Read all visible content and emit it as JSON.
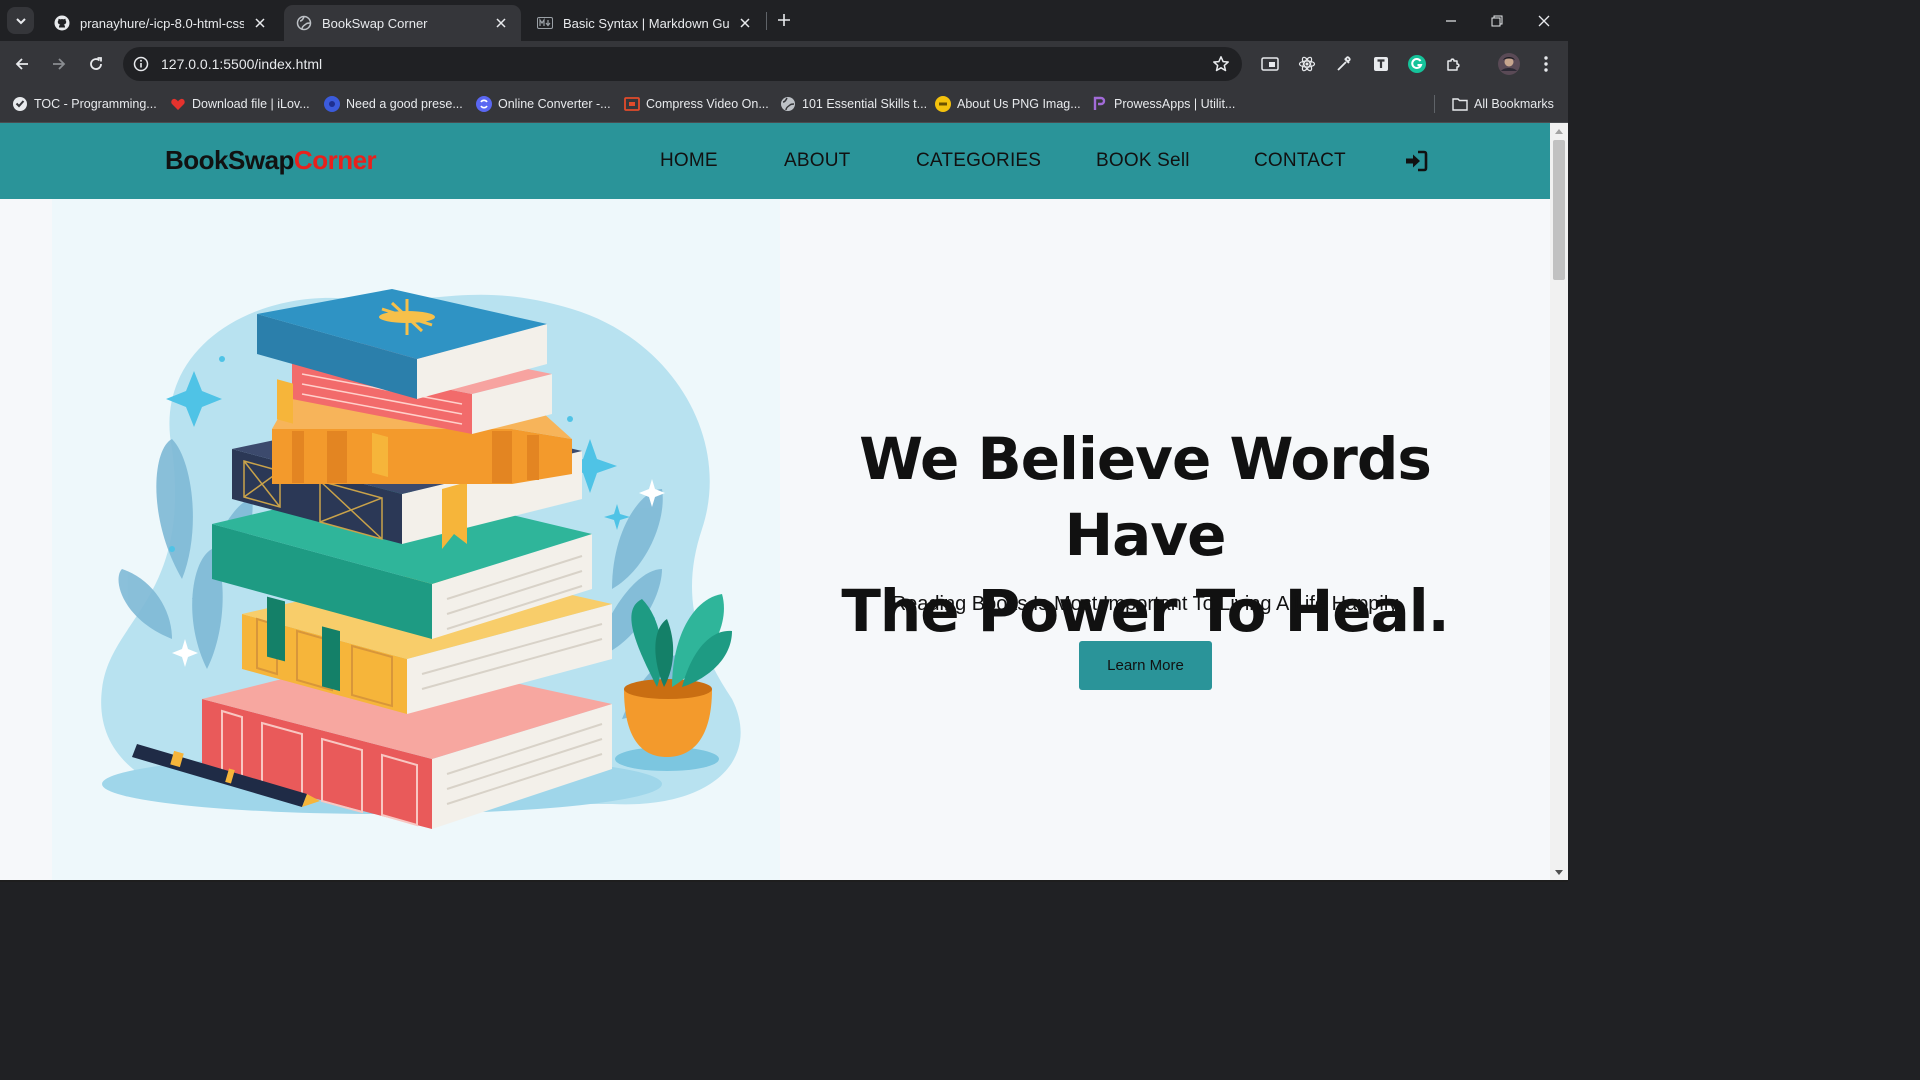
{
  "browser": {
    "tabs": [
      {
        "title": "pranayhure/-icp-8.0-html-css-g",
        "icon": "github-icon",
        "active": false
      },
      {
        "title": "BookSwap Corner",
        "icon": "globe-icon",
        "active": true
      },
      {
        "title": "Basic Syntax | Markdown Guide",
        "icon": "markdown-icon",
        "active": false
      }
    ],
    "url": "127.0.0.1:5500/index.html",
    "bookmarks": [
      {
        "label": "TOC - Programming...",
        "icon": "toc-icon",
        "color": "#e8eaed"
      },
      {
        "label": "Download file | iLov...",
        "icon": "heart-icon",
        "color": "#e5322d"
      },
      {
        "label": "Need a good prese...",
        "icon": "presentation-icon",
        "color": "#3b5bdb"
      },
      {
        "label": "Online Converter -...",
        "icon": "converter-icon",
        "color": "#5a67f2"
      },
      {
        "label": "Compress Video On...",
        "icon": "video-icon",
        "color": "#e14b2b"
      },
      {
        "label": "101 Essential Skills t...",
        "icon": "globe-icon",
        "color": "#bdc1c6"
      },
      {
        "label": "About Us PNG Imag...",
        "icon": "png-icon",
        "color": "#f4c20d"
      },
      {
        "label": "ProwessApps | Utilit...",
        "icon": "prowess-icon",
        "color": "#a26bd8"
      }
    ],
    "all_bookmarks_label": "All Bookmarks"
  },
  "site": {
    "logo_part1": "BookSwap",
    "logo_part2": "Corner",
    "nav": [
      "HOME",
      "ABOUT",
      "CATEGORIES",
      "BOOK Sell",
      "CONTACT"
    ],
    "hero": {
      "title_line1": "We Believe Words Have",
      "title_line2": "The Power To Heal.",
      "subtitle": "Reading Books Is Most Important To Living A Life Happily",
      "button": "Learn More"
    }
  },
  "colors": {
    "nav_bg": "#2a9499",
    "logo_accent": "#e8211c",
    "page_bg": "#f6f8fa",
    "chrome_dark": "#202124",
    "chrome_mid": "#35363a"
  }
}
